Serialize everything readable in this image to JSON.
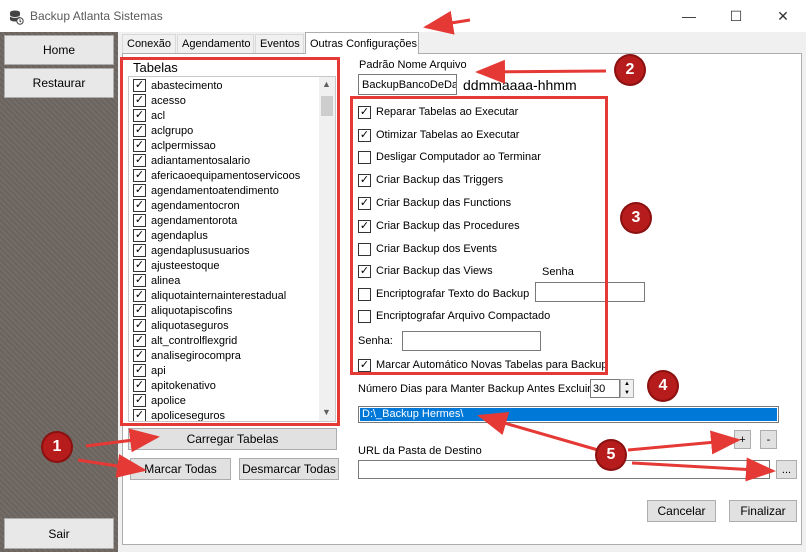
{
  "window": {
    "title": "Backup Atlanta Sistemas",
    "app_icon": "database-icon",
    "controls": {
      "minimize": "—",
      "maximize": "☐",
      "close": "✕"
    }
  },
  "sidebar": {
    "home_label": "Home",
    "restore_label": "Restaurar",
    "exit_label": "Sair",
    "footer_arrows": "▾ ▾"
  },
  "tabs": [
    "Conexão",
    "Agendamento",
    "Eventos",
    "Outras Configurações"
  ],
  "tables": {
    "label": "Tabelas",
    "items": [
      "abastecimento",
      "acesso",
      "acl",
      "aclgrupo",
      "aclpermissao",
      "adiantamentosalario",
      "afericaoequipamentoservicoos",
      "agendamentoatendimento",
      "agendamentocron",
      "agendamentorota",
      "agendaplus",
      "agendaplususuarios",
      "ajusteestoque",
      "alinea",
      "aliquotainternainterestadual",
      "aliquotapiscofins",
      "aliquotaseguros",
      "alt_controlflexgrid",
      "analisegirocompra",
      "api",
      "apitokenativo",
      "apolice",
      "apoliceseguros"
    ],
    "load_label": "Carregar Tabelas",
    "mark_all_label": "Marcar Todas",
    "unmark_all_label": "Desmarcar Todas"
  },
  "file_pattern": {
    "label": "Padrão Nome Arquivo",
    "value": "BackupBancoDeDa",
    "hint": "ddmmaaaa-hhmm"
  },
  "options": [
    {
      "label": "Reparar Tabelas ao Executar",
      "checked": true
    },
    {
      "label": "Otimizar Tabelas ao Executar",
      "checked": true
    },
    {
      "label": "Desligar Computador ao Terminar",
      "checked": false
    },
    {
      "label": "Criar Backup das Triggers",
      "checked": true
    },
    {
      "label": "Criar Backup das Functions",
      "checked": true
    },
    {
      "label": "Criar Backup das Procedures",
      "checked": true
    },
    {
      "label": "Criar Backup dos Events",
      "checked": false
    },
    {
      "label": "Criar Backup das Views",
      "checked": true
    },
    {
      "label": "Encriptografar Texto do Backup",
      "checked": false
    },
    {
      "label": "Encriptografar Arquivo Compactado",
      "checked": false
    }
  ],
  "encrypt_password_label": "Senha",
  "zip_password_label": "Senha:",
  "auto_mark_label": "Marcar Automático Novas Tabelas para Backup",
  "auto_mark_checked": true,
  "retention": {
    "label": "Número Dias para Manter Backup Antes Excluir:",
    "value": "30"
  },
  "destinations": {
    "selected_path": "D:\\_Backup Hermes\\",
    "add_label": "+",
    "remove_label": "-"
  },
  "url": {
    "label": "URL da Pasta de Destino",
    "value": "",
    "browse_label": "..."
  },
  "footer": {
    "cancel_label": "Cancelar",
    "finish_label": "Finalizar"
  },
  "annotations": {
    "accent": "#e53935",
    "badge_color": "#b71c1c",
    "badges": [
      "1",
      "2",
      "3",
      "4",
      "5"
    ]
  }
}
